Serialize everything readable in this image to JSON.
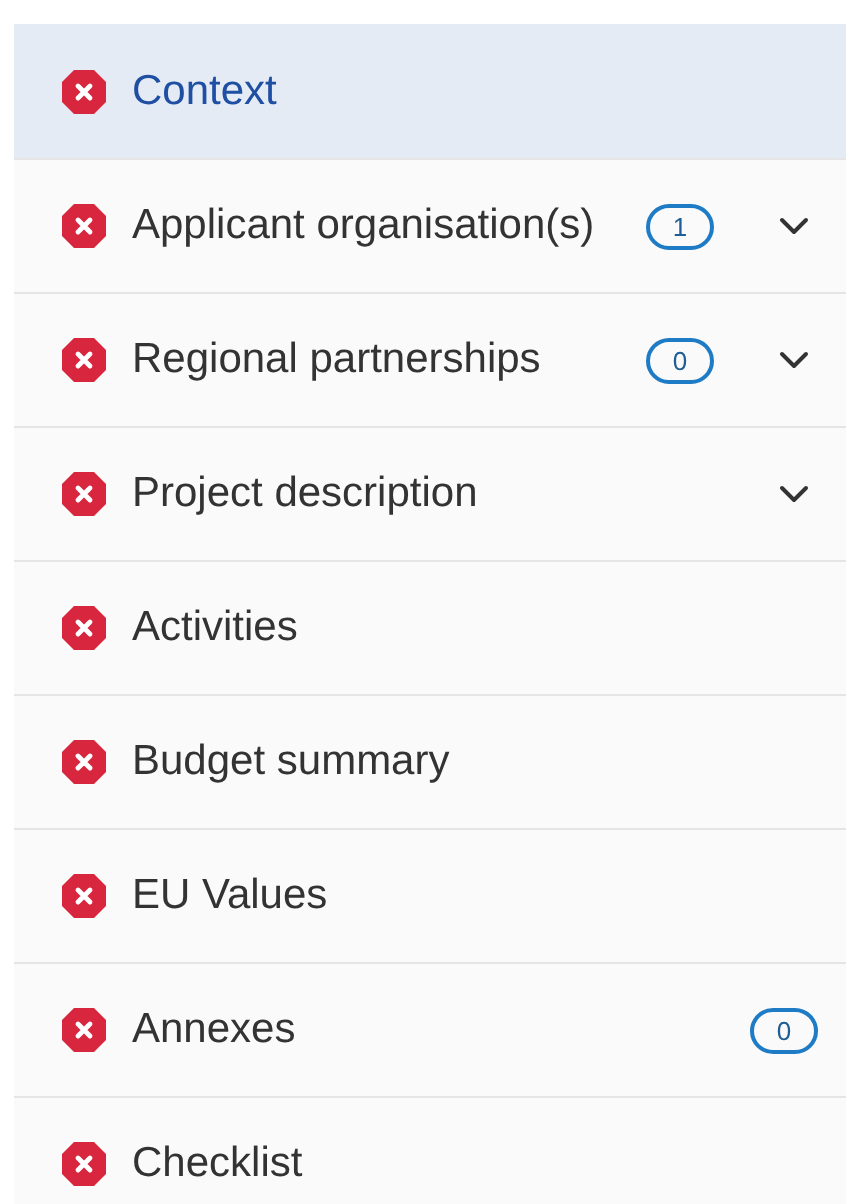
{
  "sidebar": {
    "items": [
      {
        "label": "Context",
        "selected": true,
        "expandable": false
      },
      {
        "label": "Applicant organisation(s)",
        "selected": false,
        "count": "1",
        "expandable": true
      },
      {
        "label": "Regional partnerships",
        "selected": false,
        "count": "0",
        "expandable": true
      },
      {
        "label": "Project description",
        "selected": false,
        "expandable": true
      },
      {
        "label": "Activities",
        "selected": false,
        "expandable": false
      },
      {
        "label": "Budget summary",
        "selected": false,
        "expandable": false
      },
      {
        "label": "EU Values",
        "selected": false,
        "expandable": false
      },
      {
        "label": "Annexes",
        "selected": false,
        "count": "0",
        "expandable": false
      },
      {
        "label": "Checklist",
        "selected": false,
        "expandable": false
      }
    ]
  }
}
